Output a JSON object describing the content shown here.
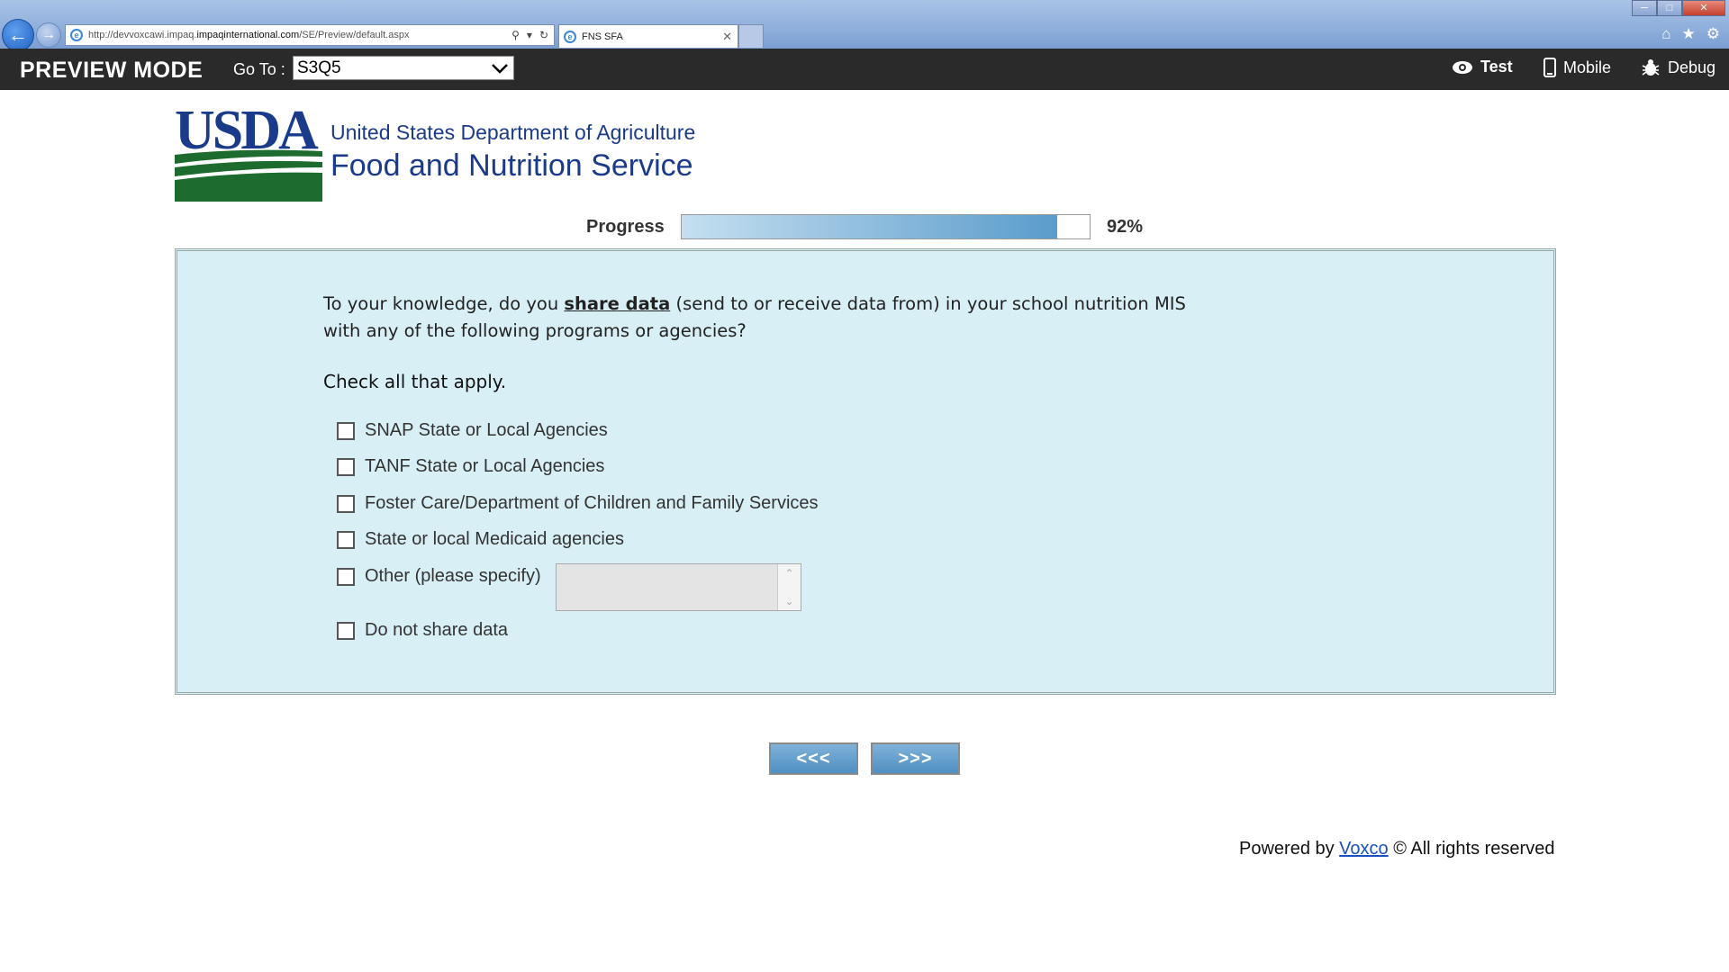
{
  "browser": {
    "url_prefix": "http://devvoxcawi.impaq.",
    "url_domain": "impaqinternational.com",
    "url_path": "/SE/Preview/default.aspx",
    "tab_title": "FNS SFA"
  },
  "toolbar": {
    "title": "PREVIEW MODE",
    "goto_label": "Go To :",
    "goto_value": "S3Q5",
    "test_label": "Test",
    "mobile_label": "Mobile",
    "debug_label": "Debug"
  },
  "header": {
    "logo_text": "USDA",
    "agency": "United States Department of Agriculture",
    "service": "Food and Nutrition Service"
  },
  "progress": {
    "label": "Progress",
    "value": 92,
    "text": "92%"
  },
  "question": {
    "text_before": "To your knowledge, do you ",
    "text_link": "share data",
    "text_after": " (send to or receive data from) in your school nutrition MIS with any of the following programs or agencies?",
    "instruction": "Check all that apply.",
    "options": [
      "SNAP State or Local Agencies",
      "TANF State or Local Agencies",
      "Foster Care/Department of Children and Family Services",
      "State or local Medicaid agencies",
      "Other (please specify)",
      "Do not share data"
    ]
  },
  "navigation": {
    "prev_label": "<<<",
    "next_label": ">>>"
  },
  "footer": {
    "prefix": "Powered by ",
    "link": "Voxco",
    "suffix": " © All rights reserved"
  },
  "colors": {
    "panel_bg": "#d8eff6",
    "toolbar_bg": "#2a2a2a",
    "brand_blue": "#1a3a8a",
    "usda_green": "#1e6b2f"
  }
}
